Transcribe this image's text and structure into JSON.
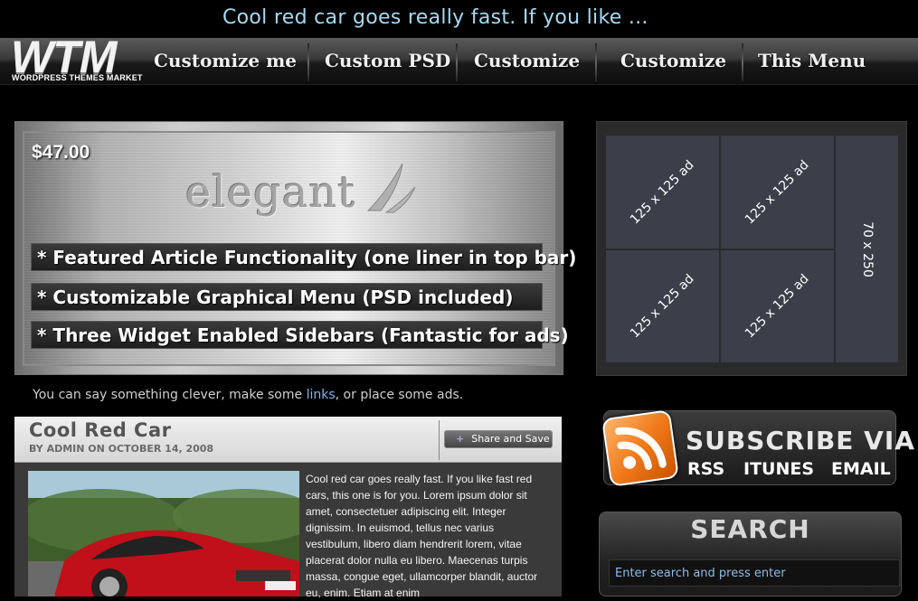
{
  "topbar": {
    "ticker": "Cool red car goes really fast. If you like ..."
  },
  "logo": {
    "big": "WTM",
    "small": "WORDPRESS THEMES MARKET"
  },
  "nav": {
    "items": [
      "Customize me",
      "Custom PSD",
      "Customize",
      "Customize",
      "This Menu"
    ]
  },
  "featured": {
    "price": "$47.00",
    "brand": "elegant",
    "features": [
      "* Featured Article Functionality (one liner in top bar)",
      "* Customizable Graphical Menu (PSD included)",
      "* Three Widget Enabled Sidebars (Fantastic for ads)"
    ]
  },
  "tagline": {
    "before": "You can say something clever, make some ",
    "link": "links",
    "after": ", or place some ads."
  },
  "post": {
    "title": "Cool Red Car",
    "meta": "BY ADMIN ON OCTOBER 14, 2008",
    "share": "Share and Save",
    "body": "Cool red car goes really fast. If you like fast red cars, this one is for you. Lorem ipsum dolor sit amet, consectetuer adipiscing elit. Integer dignissim. In euismod, tellus nec varius vestibulum, libero diam hendrerit lorem, vitae placerat dolor nulla eu libero. Maecenas turpis massa, congue eget, ullamcorper blandit, auctor eu, enim. Etiam at enim"
  },
  "ads": {
    "small": [
      "125 x 125 ad",
      "125 x 125 ad",
      "125 x 125 ad",
      "125 x 125 ad"
    ],
    "tall": "70 x 250"
  },
  "subscribe": {
    "heading": "SUBSCRIBE VIA",
    "options": [
      "RSS",
      "ITUNES",
      "EMAIL"
    ]
  },
  "search": {
    "heading": "SEARCH",
    "placeholder": "Enter search and press enter"
  },
  "colors": {
    "accent_link": "#7fb6e8",
    "ticker": "#a8d8f0",
    "rss_orange": "#f07a1a"
  }
}
